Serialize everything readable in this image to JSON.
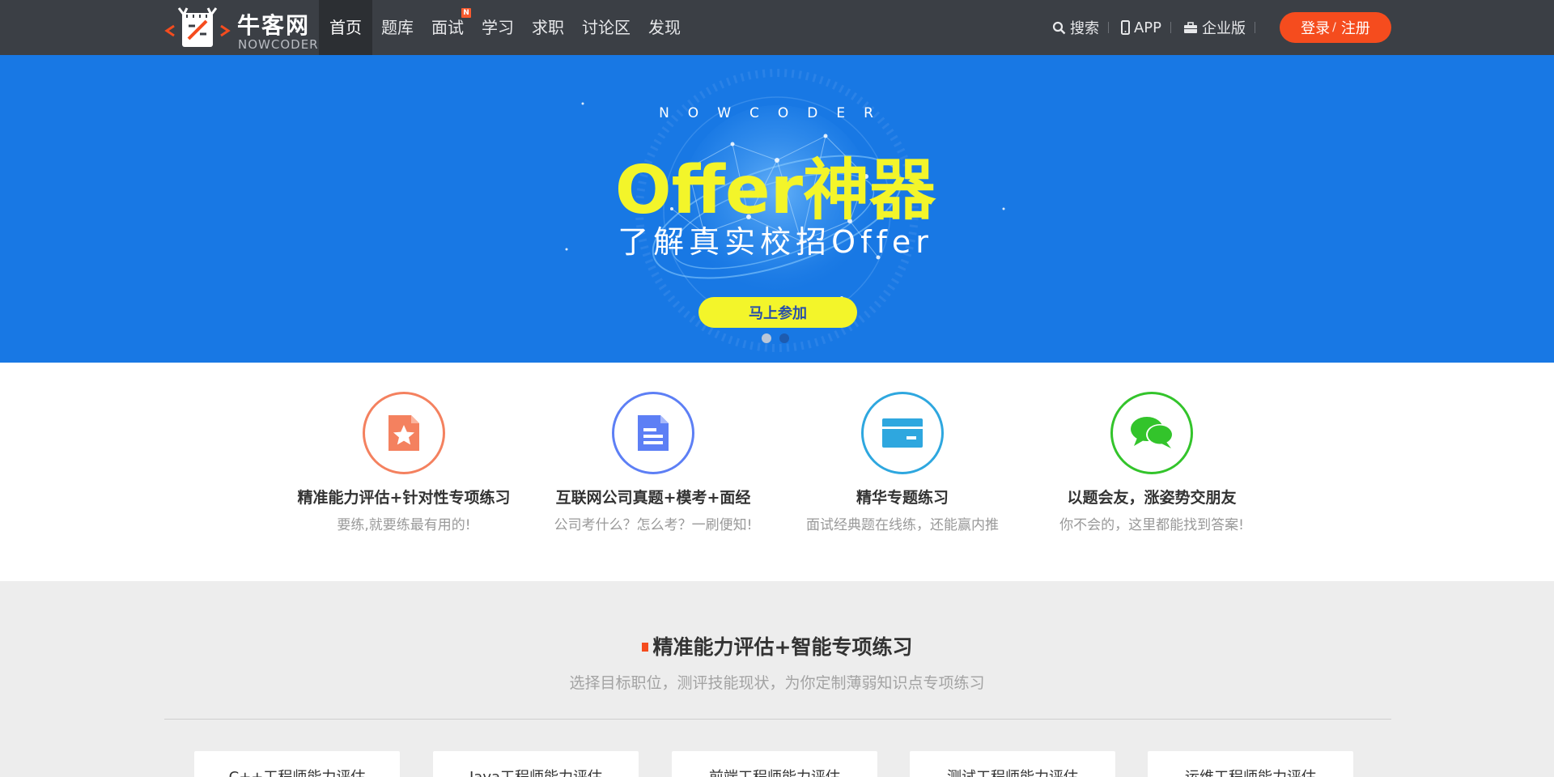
{
  "header": {
    "logo_text": "牛客网",
    "logo_sub": "NOWCODER",
    "nav": [
      {
        "label": "首页",
        "active": true
      },
      {
        "label": "题库"
      },
      {
        "label": "面试",
        "badge": "N"
      },
      {
        "label": "学习"
      },
      {
        "label": "求职"
      },
      {
        "label": "讨论区"
      },
      {
        "label": "发现"
      }
    ],
    "search_label": "搜索",
    "app_label": "APP",
    "enterprise_label": "企业版",
    "login_label": "登录",
    "register_label": "注册",
    "login_sep": "/"
  },
  "banner": {
    "brand": "NOWCODER",
    "title": "Offer神器",
    "subtitle": "了解真实校招Offer",
    "cta": "马上参加",
    "slides": 2,
    "active_slide": 1
  },
  "features": [
    {
      "icon": "star-document-icon",
      "color": "#f4815f",
      "title": "精准能力评估+针对性专项练习",
      "desc": "要练,就要练最有用的!"
    },
    {
      "icon": "document-lines-icon",
      "color": "#5d7ff5",
      "title": "互联网公司真题+模考+面经",
      "desc": "公司考什么？怎么考？一刷便知!"
    },
    {
      "icon": "envelope-icon",
      "color": "#2ea7df",
      "title": "精华专题练习",
      "desc": "面试经典题在线练，还能赢内推"
    },
    {
      "icon": "chat-bubbles-icon",
      "color": "#33c42b",
      "title": "以题会友，涨姿势交朋友",
      "desc": "你不会的，这里都能找到答案!"
    }
  ],
  "section": {
    "title": "精准能力评估+智能专项练习",
    "subtitle": "选择目标职位，测评技能现状，为你定制薄弱知识点专项练习"
  },
  "cards": [
    {
      "label": "C++工程师能力评估"
    },
    {
      "label": "Java工程师能力评估"
    },
    {
      "label": "前端工程师能力评估"
    },
    {
      "label": "测试工程师能力评估"
    },
    {
      "label": "运维工程师能力评估"
    }
  ]
}
